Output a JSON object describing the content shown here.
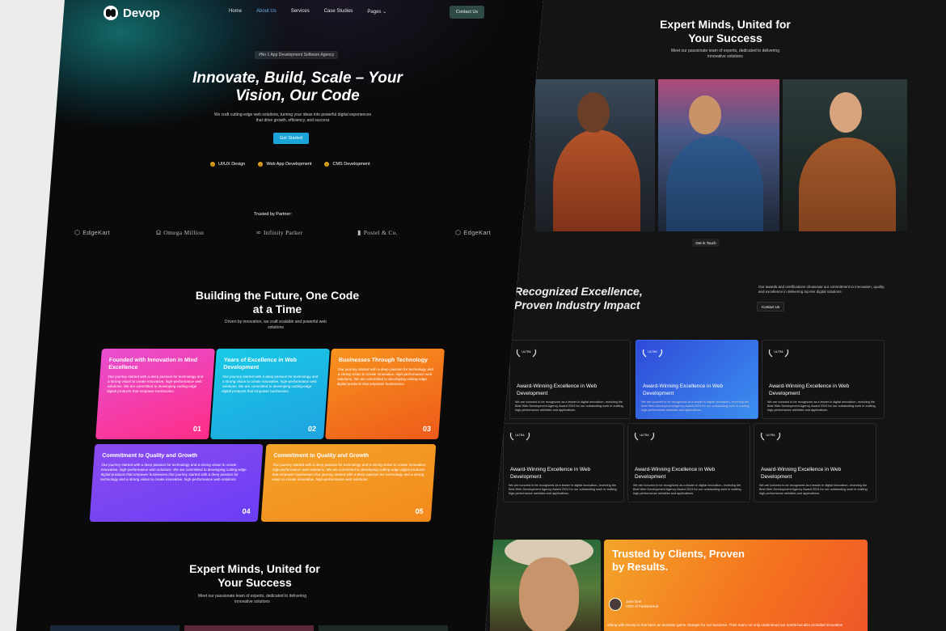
{
  "nav": {
    "logo": "Devop",
    "links": [
      "Home",
      "About Us",
      "Services",
      "Case Studies",
      "Pages"
    ],
    "active": "About Us",
    "contact": "Contact Us"
  },
  "hero": {
    "badge": "#No 1 App Development Software Agency",
    "title": "Innovate, Build, Scale – Your Vision, Our Code",
    "subtitle": "We craft cutting-edge web solutions, turning your ideas into powerful digital experiences that drive growth, efficiency, and success",
    "cta": "Get Started",
    "features": [
      "UI/UX Design",
      "Web App Development",
      "CMS Development"
    ]
  },
  "partners": {
    "label": "Trusted by Partner:",
    "items": [
      "EdgeKart",
      "Omega Million",
      "Infinity Parker",
      "Postel & Co.",
      "EdgeKart"
    ]
  },
  "building": {
    "title": "Building the Future, One Code at a Time",
    "subtitle": "Driven by innovation, we craft scalable and powerful web solutions",
    "cards": [
      {
        "title": "Founded with Innovation in Mind Excellence",
        "text": "Our journey started with a deep passion for technology and a strong vision to create innovative, high-performance web solutions. We are committed to developing cutting-edge digital products that empower businesses.",
        "num": "01",
        "color": "#ff2d86"
      },
      {
        "title": "Years of Excellence in Web Development",
        "text": "Our journey started with a deep passion for technology and a strong vision to create innovative, high-performance web solutions. We are committed to developing cutting-edge digital products that empower businesses.",
        "num": "02",
        "color": "#1fa3e0"
      },
      {
        "title": "Businesses Through Technology",
        "text": "Our journey started with a deep passion for technology and a strong vision to create innovative, high-performance web solutions. We are committed to developing cutting-edge digital products that empower businesses.",
        "num": "03",
        "color": "#ee5a1a"
      },
      {
        "title": "Commitment to Quality and Growth",
        "text": "Our journey started with a deep passion for technology and a strong vision to create innovative, high-performance web solutions. We are committed to developing cutting-edge digital products that empower businesses.Our journey started with a deep passion for technology and a strong vision to create innovative, high-performance web solutions.",
        "num": "04",
        "color": "#6b3df5"
      },
      {
        "title": "Commitment to Quality and Growth",
        "text": "Our journey started with a deep passion for technology and a strong vision to create innovative, high-performance web solutions. We are committed to developing cutting-edge digital products that empower businesses.Our journey started with a deep passion for technology and a strong vision to create innovative, high-performance web solutions.",
        "num": "05",
        "color": "#f38a1c"
      }
    ]
  },
  "team": {
    "title": "Expert Minds, United for Your Success",
    "subtitle": "Meet our passionate team of experts, dedicated to delivering innovative solutions",
    "cta": "Get in Touch"
  },
  "recognition": {
    "title": "Recognized Excellence, Proven Industry Impact",
    "desc": "Our awards and certifications showcase our commitment to innovation, quality, and excellence in delivering top-tier digital solutions.",
    "cta": "Contact Us",
    "award_title": "Award-Winning Excellence in Web Development",
    "award_text": "We are honored to be recognized as a leader in digital innovation, receiving the Best Web Development Agency Award 2024 for our outstanding work in crafting high-performance websites and applications.",
    "laurel_text": "ULTRA"
  },
  "testimonial": {
    "title": "Trusted by Clients, Proven by Results.",
    "author": "Jane Doe",
    "role": "CEO of FashionHub",
    "quote": "orking with Devop.io has been an absolute game changer for our business. Their team not only understood our needs but also provided innovative"
  },
  "colors": {
    "accent_blue": "#1aa4d8",
    "feature_check": "#e0a21a",
    "award_highlight": "#2f4ad8",
    "testimonial_orange": "#f4741e"
  }
}
